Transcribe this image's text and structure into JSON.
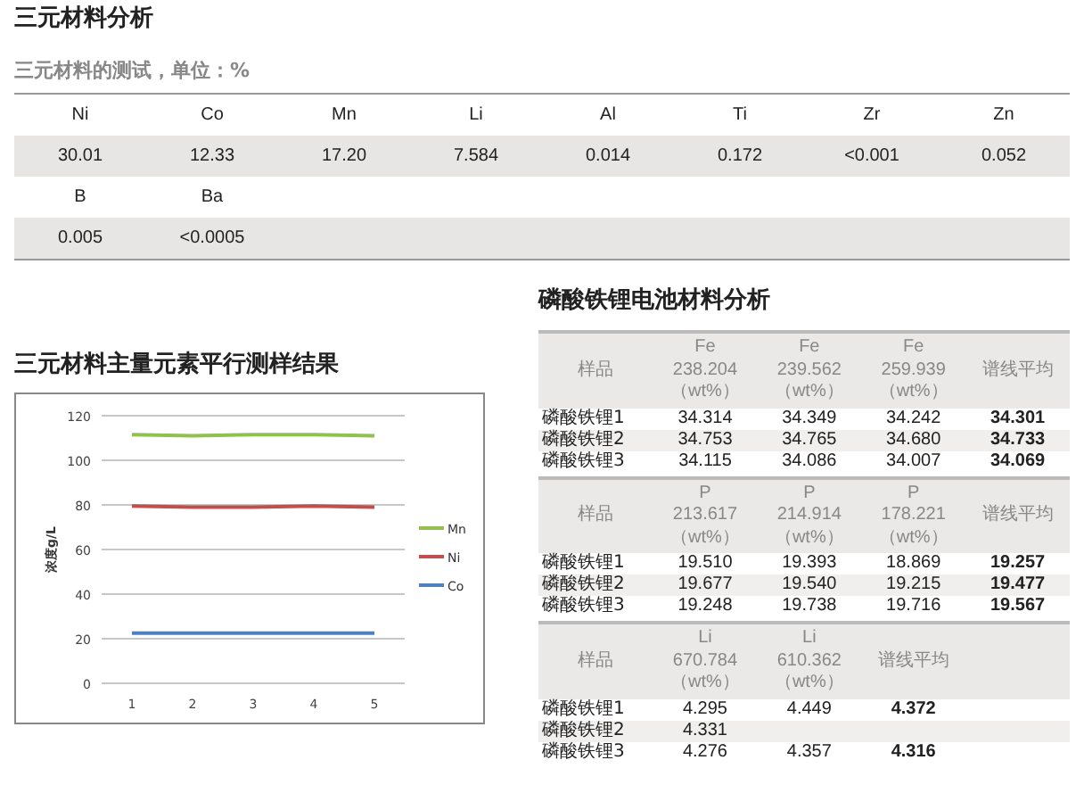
{
  "title": "三元材料分析",
  "subtitle": "三元材料的测试，单位：%",
  "element_table": [
    {
      "elements": [
        "Ni",
        "Co",
        "Mn",
        "Li",
        "Al",
        "Ti",
        "Zr",
        "Zn"
      ],
      "values": [
        "30.01",
        "12.33",
        "17.20",
        "7.584",
        "0.014",
        "0.172",
        "<0.001",
        "0.052"
      ]
    },
    {
      "elements": [
        "B",
        "Ba"
      ],
      "values": [
        "0.005",
        "<0.0005"
      ]
    }
  ],
  "chart_section": {
    "title": "三元材料主量元素平行测样结果",
    "chart_data": {
      "type": "line",
      "ylabel": "浓度g/L",
      "x": [
        1,
        2,
        3,
        4,
        5
      ],
      "ylim": [
        0,
        120
      ],
      "yticks": [
        0,
        20,
        40,
        60,
        80,
        100,
        120
      ],
      "xticks": [
        1,
        2,
        3,
        4,
        5
      ],
      "xlim": [
        0.5,
        5.5
      ],
      "grid": true,
      "legend": true,
      "series": [
        {
          "name": "Mn",
          "color": "#92c050",
          "values": [
            111.5,
            111,
            111.5,
            111.5,
            111
          ]
        },
        {
          "name": "Ni",
          "color": "#c0504d",
          "values": [
            79.5,
            79,
            79,
            79.5,
            79
          ]
        },
        {
          "name": "Co",
          "color": "#4f81bd",
          "values": [
            22.5,
            22.5,
            22.5,
            22.5,
            22.5
          ]
        }
      ]
    }
  },
  "lfp_section": {
    "title": "磷酸铁锂电池材料分析",
    "blocks": [
      {
        "sample_header": "样品",
        "columns": [
          "Fe\n238.204\n（wt%）",
          "Fe\n239.562\n（wt%）",
          "Fe\n259.939\n（wt%）"
        ],
        "average_header": "谱线平均",
        "rows": [
          {
            "sample": "磷酸铁锂1",
            "values": [
              "34.314",
              "34.349",
              "34.242"
            ],
            "average": "34.301"
          },
          {
            "sample": "磷酸铁锂2",
            "values": [
              "34.753",
              "34.765",
              "34.680"
            ],
            "average": "34.733"
          },
          {
            "sample": "磷酸铁锂3",
            "values": [
              "34.115",
              "34.086",
              "34.007"
            ],
            "average": "34.069"
          }
        ]
      },
      {
        "sample_header": "样品",
        "columns": [
          "P\n213.617\n（wt%）",
          "P\n214.914\n（wt%）",
          "P\n178.221\n（wt%）"
        ],
        "average_header": "谱线平均",
        "rows": [
          {
            "sample": "磷酸铁锂1",
            "values": [
              "19.510",
              "19.393",
              "18.869"
            ],
            "average": "19.257"
          },
          {
            "sample": "磷酸铁锂2",
            "values": [
              "19.677",
              "19.540",
              "19.215"
            ],
            "average": "19.477"
          },
          {
            "sample": "磷酸铁锂3",
            "values": [
              "19.248",
              "19.738",
              "19.716"
            ],
            "average": "19.567"
          }
        ]
      },
      {
        "sample_header": "样品",
        "columns": [
          "Li\n670.784\n（wt%）",
          "Li\n610.362\n（wt%）"
        ],
        "average_header": "谱线平均",
        "rows": [
          {
            "sample": "磷酸铁锂1",
            "values": [
              "4.295",
              "4.449"
            ],
            "average": "4.372"
          },
          {
            "sample": "磷酸铁锂2",
            "values": [
              "4.331"
            ]
          },
          {
            "sample": "磷酸铁锂3",
            "values": [
              "4.276",
              "4.357"
            ],
            "average": "4.316"
          }
        ]
      }
    ]
  }
}
